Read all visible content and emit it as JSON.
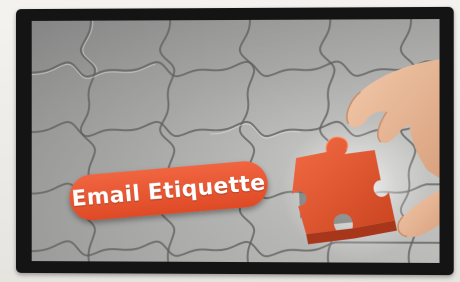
{
  "slide": {
    "title": "Email Etiquette"
  },
  "colors": {
    "accent": "#e8552f",
    "puzzle": "#9c9d9b",
    "bezel": "#141414"
  },
  "icons": {
    "hand": "hand-holding-piece-icon",
    "piece": "puzzle-piece-icon"
  }
}
